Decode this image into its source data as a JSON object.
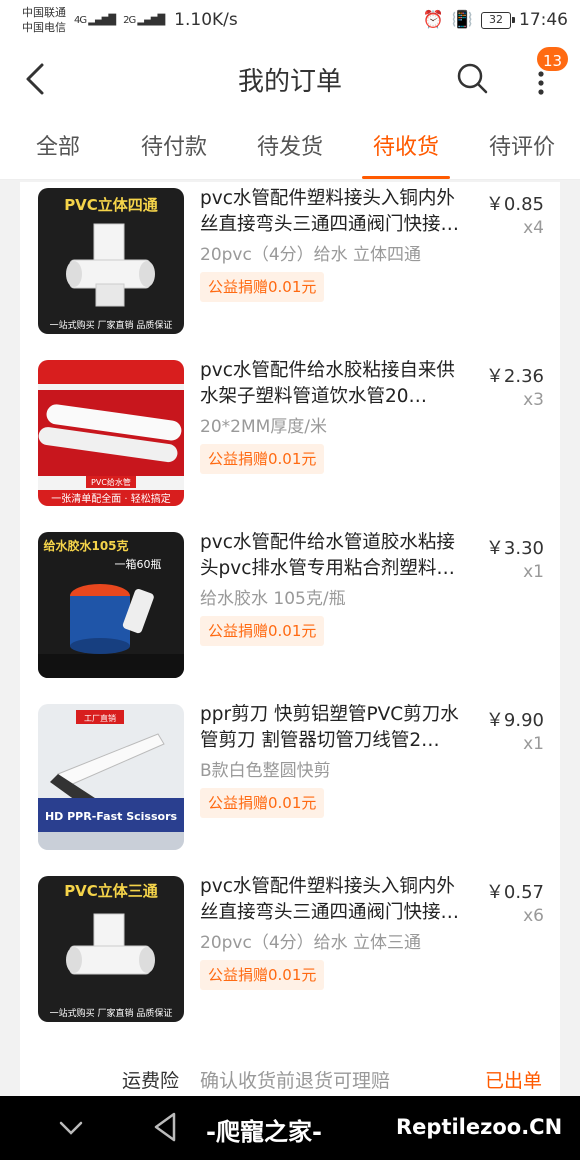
{
  "status_bar": {
    "carrier_1": "中国联通",
    "carrier_2": "中国电信",
    "signal_1": "4G",
    "signal_2": "2G",
    "speed": "1.10K/s",
    "battery": "32",
    "time": "17:46"
  },
  "header": {
    "title": "我的订单",
    "badge_count": "13"
  },
  "tabs": [
    {
      "label": "全部",
      "active": false
    },
    {
      "label": "待付款",
      "active": false
    },
    {
      "label": "待发货",
      "active": false
    },
    {
      "label": "待收货",
      "active": true
    },
    {
      "label": "待评价",
      "active": false
    }
  ],
  "items": [
    {
      "thumb_caption": "PVC立体四通",
      "thumb_footer": "一站式购买 厂家直销 品质保证",
      "title": "pvc水管配件塑料接头入铜内外丝直接弯头三通四通阀门快接…",
      "spec": "20pvc（4分）给水 立体四通",
      "donate": "公益捐赠0.01元",
      "price": "￥0.85",
      "qty": "x4"
    },
    {
      "thumb_caption": "PVC给水管",
      "thumb_footer": "一张清单配全面 · 轻松搞定",
      "title": "pvc水管配件给水胶粘接自来供水架子塑料管道饮水管20…",
      "spec": "20*2MM厚度/米",
      "donate": "公益捐赠0.01元",
      "price": "￥2.36",
      "qty": "x3"
    },
    {
      "thumb_caption": "给水胶水105克",
      "thumb_sub": "一箱60瓶",
      "title": "pvc水管配件给水管道胶水粘接头pvc排水管专用粘合剂塑料…",
      "spec": "给水胶水 105克/瓶",
      "donate": "公益捐赠0.01元",
      "price": "￥3.30",
      "qty": "x1"
    },
    {
      "thumb_caption": "工厂直销",
      "thumb_footer": "HD PPR-Fast Scissors",
      "title": "ppr剪刀 快剪铝塑管PVC剪刀水管剪刀 割管器切管刀线管2…",
      "spec": "B款白色整圆快剪",
      "donate": "公益捐赠0.01元",
      "price": "￥9.90",
      "qty": "x1"
    },
    {
      "thumb_caption": "PVC立体三通",
      "thumb_footer": "一站式购买 厂家直销 品质保证",
      "title": "pvc水管配件塑料接头入铜内外丝直接弯头三通四通阀门快接…",
      "spec": "20pvc（4分）给水 立体三通",
      "donate": "公益捐赠0.01元",
      "price": "￥0.57",
      "qty": "x6"
    }
  ],
  "insurance": {
    "label": "运费险",
    "description": "确认收货前退货可理赔",
    "status": "已出单"
  },
  "watermark": {
    "text": "-爬寵之家-",
    "site": "Reptilezoo.CN"
  },
  "colors": {
    "accent": "#ff5a00",
    "badge": "#ff6a12"
  }
}
